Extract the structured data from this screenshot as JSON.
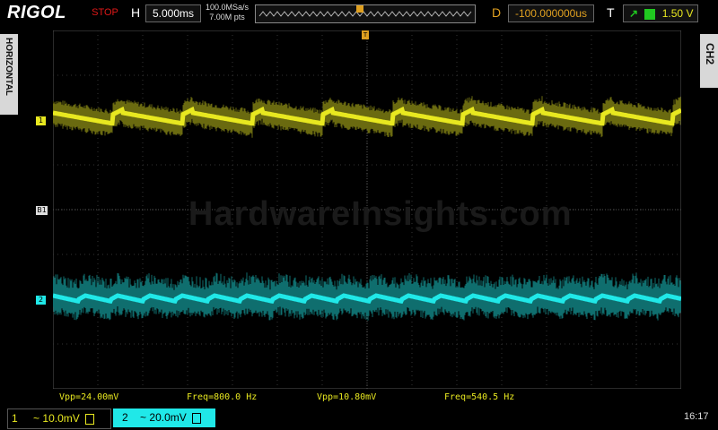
{
  "brand": "RIGOL",
  "run_status": "STOP",
  "timebase": {
    "letter": "H",
    "value": "5.000ms"
  },
  "sample_rate": "100.0MSa/s",
  "memory_depth": "7.00M pts",
  "trigger_delay": {
    "letter": "D",
    "value": "-100.000000us"
  },
  "trigger": {
    "letter": "T",
    "level": "1.50 V",
    "marker": "T"
  },
  "side_tab_left": "HORIZONTAL",
  "side_tab_right": "CH2",
  "channel_markers": {
    "ch1": "1",
    "ref": "B1",
    "ch2": "2"
  },
  "measurements": [
    {
      "text": "Vpp=24.00mV",
      "color": "#e8e820"
    },
    {
      "text": "Freq=800.0 Hz",
      "color": "#e8e820"
    },
    {
      "text": "Vpp=10.80mV",
      "color": "#e8e820"
    },
    {
      "text": "Freq=540.5 Hz",
      "color": "#e8e820"
    }
  ],
  "channels": [
    {
      "number": "1",
      "coupling": "~",
      "scale": "10.0mV",
      "color": "#e8e820"
    },
    {
      "number": "2",
      "coupling": "~",
      "scale": "20.0mV",
      "color": "#20e8e8"
    }
  ],
  "clock": "16:17",
  "watermark": "HardwareInsights.com",
  "colors": {
    "ch1": "#e8e820",
    "ch2": "#20e8e8",
    "trigger": "#e0a020",
    "stop": "#e01818"
  },
  "icons": {
    "trigger_edge": "rising-edge-icon",
    "dc_coupling": "dc-coupling-icon"
  }
}
